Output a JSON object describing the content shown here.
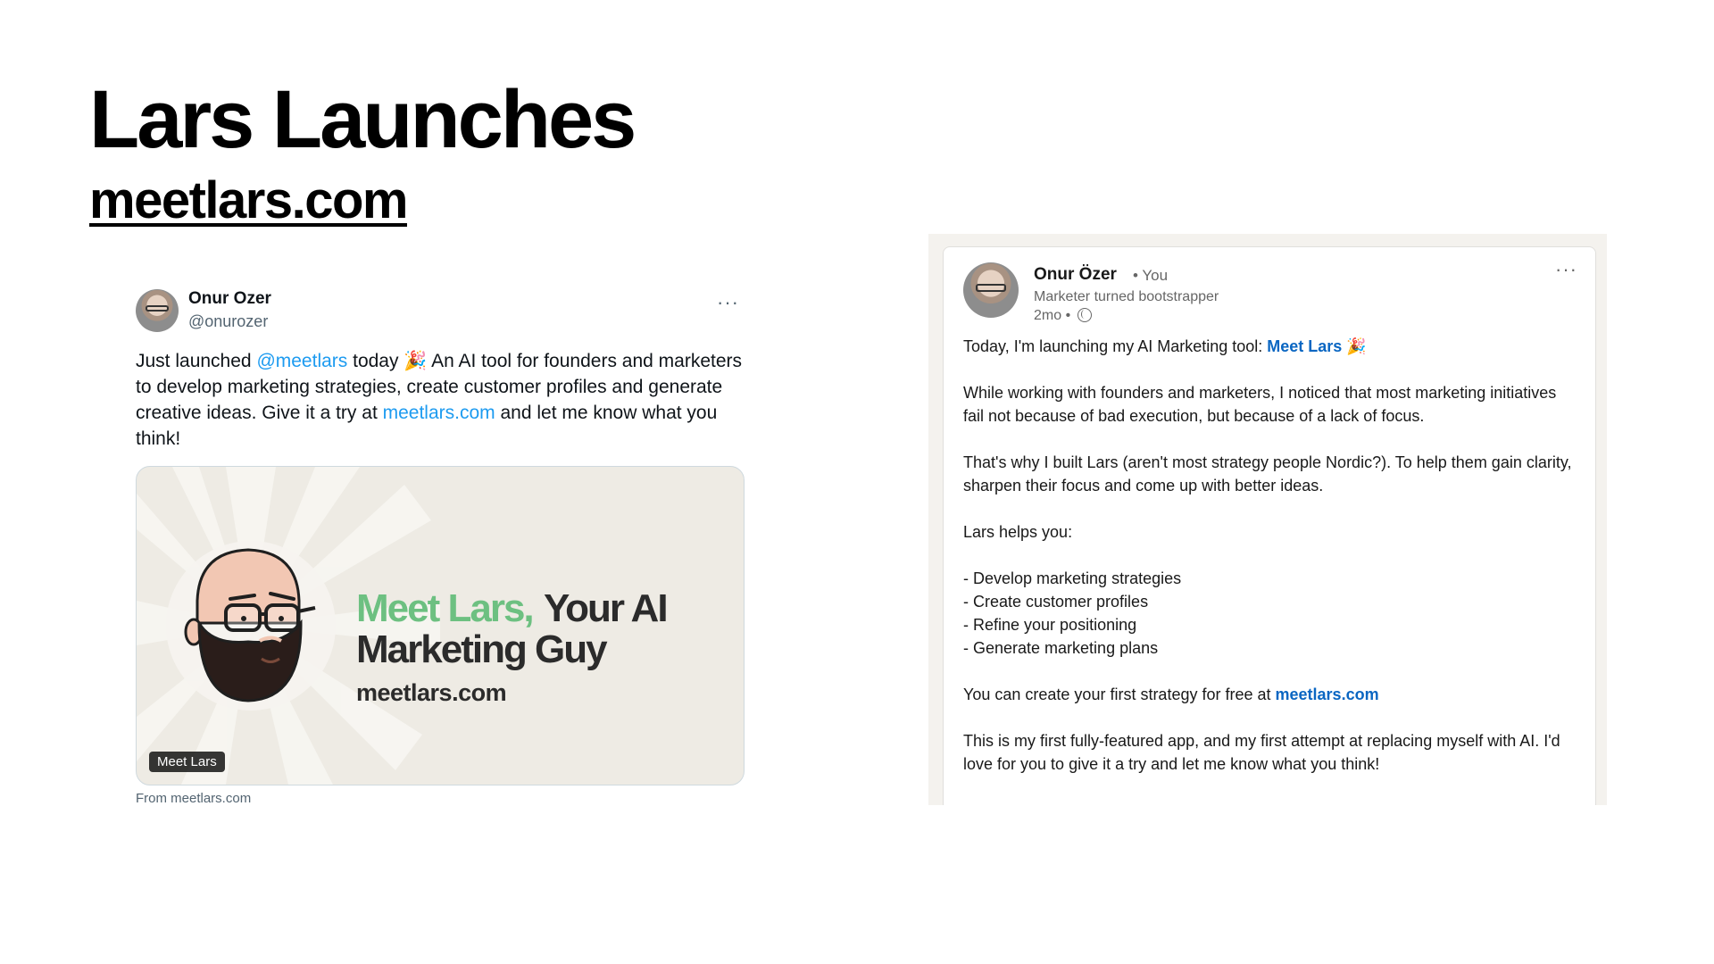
{
  "slide": {
    "title": "Lars Launches",
    "link": "meetlars.com"
  },
  "tweet": {
    "author_name": "Onur Ozer",
    "author_handle": "@onurozer",
    "more_icon": "···",
    "text_1": "Just launched ",
    "mention": "@meetlars",
    "text_2": " today 🎉 An AI tool for founders and marketers to develop marketing strategies, create customer profiles and generate creative ideas. Give it a try at ",
    "link": "meetlars.com",
    "text_3": " and let me know what you think!",
    "card": {
      "title_green": "Meet Lars,",
      "title_dark_1": "Your AI",
      "title_dark_2": "Marketing Guy",
      "domain": "meetlars.com",
      "badge": "Meet Lars"
    },
    "source": "From meetlars.com"
  },
  "linkedin": {
    "author_name": "Onur Özer",
    "you_label": "• You",
    "headline": "Marketer turned bootstrapper",
    "time": "2mo •",
    "more_icon": "···",
    "p1_text": "Today, I'm launching my AI Marketing tool: ",
    "p1_link": "Meet Lars",
    "p1_emoji": " 🎉",
    "p2": "While working with founders and marketers, I noticed that most marketing initiatives fail not because of bad execution, but because of a lack of focus.",
    "p3": "That's why I built Lars (aren't most strategy people Nordic?). To help them gain clarity, sharpen their focus and come up with better ideas.",
    "p4": "Lars helps you:",
    "list": [
      "- Develop marketing strategies",
      "- Create customer profiles",
      "- Refine your positioning",
      "- Generate marketing plans"
    ],
    "p5_text": "You can create your first strategy for free at ",
    "p5_link": "meetlars.com",
    "p6": "This is my first fully-featured app, and my first attempt at replacing myself with AI. I'd love for you to give it a try and let me know what you think!"
  },
  "colors": {
    "twitter_link": "#1d9bf0",
    "linkedin_link": "#0a66c2",
    "card_green": "#6dc081",
    "card_bg": "#eeebe4"
  }
}
